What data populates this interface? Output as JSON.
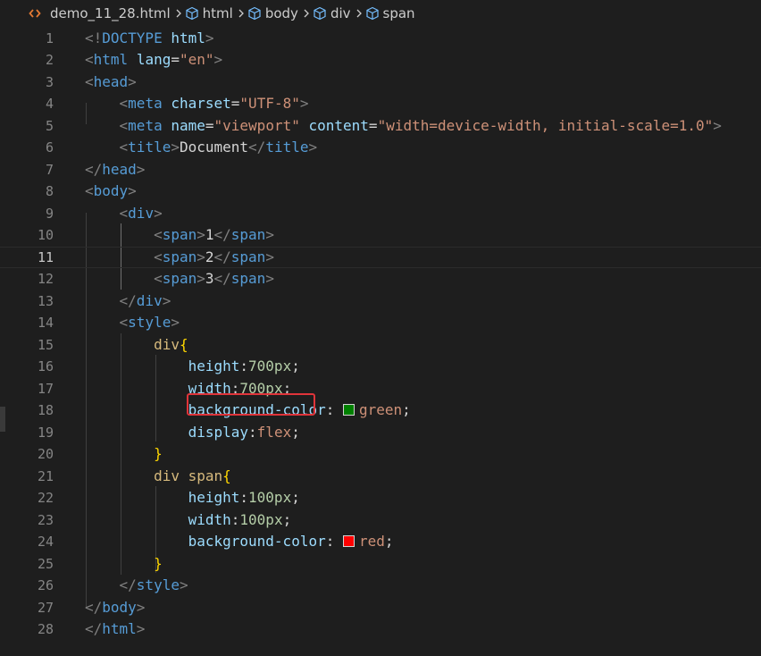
{
  "breadcrumb": {
    "file": "demo_11_28.html",
    "path": [
      "html",
      "body",
      "div",
      "span"
    ]
  },
  "colors": {
    "tag": "#569cd6",
    "attribute": "#9cdcfe",
    "string": "#ce9178",
    "selector": "#d7ba7d",
    "number": "#b5cea8",
    "highlight": "#e0343a",
    "swatch_green": "#008000",
    "swatch_red": "#ff0000"
  },
  "editor": {
    "current_line": 11,
    "highlighted_line": 19,
    "lines": [
      {
        "num": "1",
        "tokens": [
          [
            "br",
            "<!"
          ],
          [
            "tag",
            "DOCTYPE"
          ],
          [
            "text",
            " "
          ],
          [
            "attr",
            "html"
          ],
          [
            "br",
            ">"
          ]
        ]
      },
      {
        "num": "2",
        "tokens": [
          [
            "br",
            "<"
          ],
          [
            "tag",
            "html"
          ],
          [
            "text",
            " "
          ],
          [
            "attr",
            "lang"
          ],
          [
            "text",
            "="
          ],
          [
            "str",
            "\"en\""
          ],
          [
            "br",
            ">"
          ]
        ]
      },
      {
        "num": "3",
        "tokens": [
          [
            "br",
            "<"
          ],
          [
            "tag",
            "head"
          ],
          [
            "br",
            ">"
          ]
        ]
      },
      {
        "num": "4",
        "tokens": [
          [
            "text",
            "    "
          ],
          [
            "br",
            "<"
          ],
          [
            "tag",
            "meta"
          ],
          [
            "text",
            " "
          ],
          [
            "attr",
            "charset"
          ],
          [
            "text",
            "="
          ],
          [
            "str",
            "\"UTF-8\""
          ],
          [
            "br",
            ">"
          ]
        ]
      },
      {
        "num": "5",
        "tokens": [
          [
            "text",
            "    "
          ],
          [
            "br",
            "<"
          ],
          [
            "tag",
            "meta"
          ],
          [
            "text",
            " "
          ],
          [
            "attr",
            "name"
          ],
          [
            "text",
            "="
          ],
          [
            "str",
            "\"viewport\""
          ],
          [
            "text",
            " "
          ],
          [
            "attr",
            "content"
          ],
          [
            "text",
            "="
          ],
          [
            "str",
            "\"width=device-width, initial-scale=1.0\""
          ],
          [
            "br",
            ">"
          ]
        ]
      },
      {
        "num": "6",
        "tokens": [
          [
            "text",
            "    "
          ],
          [
            "br",
            "<"
          ],
          [
            "tag",
            "title"
          ],
          [
            "br",
            ">"
          ],
          [
            "text",
            "Document"
          ],
          [
            "br",
            "</"
          ],
          [
            "tag",
            "title"
          ],
          [
            "br",
            ">"
          ]
        ]
      },
      {
        "num": "7",
        "tokens": [
          [
            "br",
            "</"
          ],
          [
            "tag",
            "head"
          ],
          [
            "br",
            ">"
          ]
        ]
      },
      {
        "num": "8",
        "tokens": [
          [
            "br",
            "<"
          ],
          [
            "tag",
            "body"
          ],
          [
            "br",
            ">"
          ]
        ]
      },
      {
        "num": "9",
        "tokens": [
          [
            "text",
            "    "
          ],
          [
            "br",
            "<"
          ],
          [
            "tag",
            "div"
          ],
          [
            "br",
            ">"
          ]
        ]
      },
      {
        "num": "10",
        "tokens": [
          [
            "text",
            "        "
          ],
          [
            "br",
            "<"
          ],
          [
            "tag",
            "span"
          ],
          [
            "br",
            ">"
          ],
          [
            "text",
            "1"
          ],
          [
            "br",
            "</"
          ],
          [
            "tag",
            "span"
          ],
          [
            "br",
            ">"
          ]
        ]
      },
      {
        "num": "11",
        "tokens": [
          [
            "text",
            "        "
          ],
          [
            "br",
            "<"
          ],
          [
            "tag",
            "span"
          ],
          [
            "br",
            ">"
          ],
          [
            "text",
            "2"
          ],
          [
            "br",
            "</"
          ],
          [
            "tag",
            "span"
          ],
          [
            "br",
            ">"
          ]
        ]
      },
      {
        "num": "12",
        "tokens": [
          [
            "text",
            "        "
          ],
          [
            "br",
            "<"
          ],
          [
            "tag",
            "span"
          ],
          [
            "br",
            ">"
          ],
          [
            "text",
            "3"
          ],
          [
            "br",
            "</"
          ],
          [
            "tag",
            "span"
          ],
          [
            "br",
            ">"
          ]
        ]
      },
      {
        "num": "13",
        "tokens": [
          [
            "text",
            "    "
          ],
          [
            "br",
            "</"
          ],
          [
            "tag",
            "div"
          ],
          [
            "br",
            ">"
          ]
        ]
      },
      {
        "num": "14",
        "tokens": [
          [
            "text",
            "    "
          ],
          [
            "br",
            "<"
          ],
          [
            "tag",
            "style"
          ],
          [
            "br",
            ">"
          ]
        ]
      },
      {
        "num": "15",
        "tokens": [
          [
            "text",
            "        "
          ],
          [
            "sel",
            "div"
          ],
          [
            "curly",
            "{"
          ]
        ]
      },
      {
        "num": "16",
        "tokens": [
          [
            "text",
            "            "
          ],
          [
            "attr",
            "height"
          ],
          [
            "text",
            ":"
          ],
          [
            "num",
            "700px"
          ],
          [
            "text",
            ";"
          ]
        ]
      },
      {
        "num": "17",
        "tokens": [
          [
            "text",
            "            "
          ],
          [
            "attr",
            "width"
          ],
          [
            "text",
            ":"
          ],
          [
            "num",
            "700px"
          ],
          [
            "text",
            ";"
          ]
        ]
      },
      {
        "num": "18",
        "tokens": [
          [
            "text",
            "            "
          ],
          [
            "attr",
            "background-color"
          ],
          [
            "text",
            ": "
          ],
          [
            "swatch",
            "green"
          ],
          [
            "str",
            "green"
          ],
          [
            "text",
            ";"
          ]
        ]
      },
      {
        "num": "19",
        "tokens": [
          [
            "text",
            "            "
          ],
          [
            "attr",
            "display"
          ],
          [
            "text",
            ":"
          ],
          [
            "str",
            "flex"
          ],
          [
            "text",
            ";"
          ]
        ]
      },
      {
        "num": "20",
        "tokens": [
          [
            "text",
            "        "
          ],
          [
            "curly",
            "}"
          ]
        ]
      },
      {
        "num": "21",
        "tokens": [
          [
            "text",
            "        "
          ],
          [
            "sel",
            "div span"
          ],
          [
            "curly",
            "{"
          ]
        ]
      },
      {
        "num": "22",
        "tokens": [
          [
            "text",
            "            "
          ],
          [
            "attr",
            "height"
          ],
          [
            "text",
            ":"
          ],
          [
            "num",
            "100px"
          ],
          [
            "text",
            ";"
          ]
        ]
      },
      {
        "num": "23",
        "tokens": [
          [
            "text",
            "            "
          ],
          [
            "attr",
            "width"
          ],
          [
            "text",
            ":"
          ],
          [
            "num",
            "100px"
          ],
          [
            "text",
            ";"
          ]
        ]
      },
      {
        "num": "24",
        "tokens": [
          [
            "text",
            "            "
          ],
          [
            "attr",
            "background-color"
          ],
          [
            "text",
            ": "
          ],
          [
            "swatch",
            "red"
          ],
          [
            "str",
            "red"
          ],
          [
            "text",
            ";"
          ]
        ]
      },
      {
        "num": "25",
        "tokens": [
          [
            "text",
            "        "
          ],
          [
            "curly",
            "}"
          ]
        ]
      },
      {
        "num": "26",
        "tokens": [
          [
            "text",
            "    "
          ],
          [
            "br",
            "</"
          ],
          [
            "tag",
            "style"
          ],
          [
            "br",
            ">"
          ]
        ]
      },
      {
        "num": "27",
        "tokens": [
          [
            "br",
            "</"
          ],
          [
            "tag",
            "body"
          ],
          [
            "br",
            ">"
          ]
        ]
      },
      {
        "num": "28",
        "tokens": [
          [
            "br",
            "</"
          ],
          [
            "tag",
            "html"
          ],
          [
            "br",
            ">"
          ]
        ]
      }
    ]
  }
}
